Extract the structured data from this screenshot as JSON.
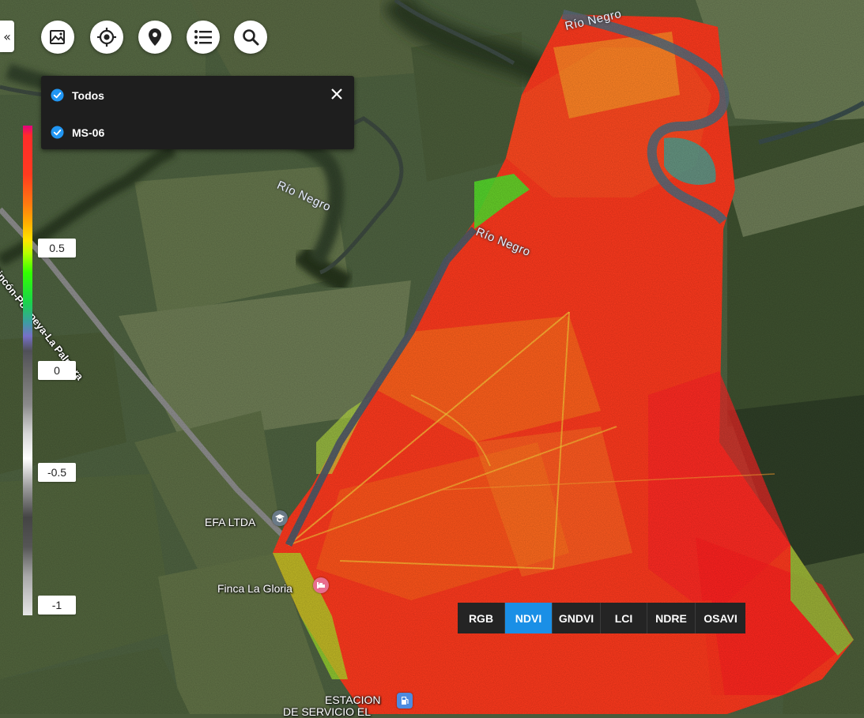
{
  "toolbar": {
    "collapse_symbol": "«",
    "buttons": [
      {
        "icon": "image-layer-icon"
      },
      {
        "icon": "locate-icon"
      },
      {
        "icon": "map-pin-icon"
      },
      {
        "icon": "list-icon"
      },
      {
        "icon": "search-icon"
      }
    ]
  },
  "layers_panel": {
    "items": [
      {
        "label": "Todos",
        "checked": true
      },
      {
        "label": "MS-06",
        "checked": true
      }
    ],
    "check_color": "#2196f3"
  },
  "legend": {
    "labels": [
      "0.5",
      "0",
      "-0.5",
      "-1"
    ]
  },
  "index_switcher": {
    "options": [
      "RGB",
      "NDVI",
      "GNDVI",
      "LCI",
      "NDRE",
      "OSAVI"
    ],
    "active": "NDVI",
    "accent": "#1a8fe6"
  },
  "map": {
    "rivers": [
      "Río Negro",
      "Río Negro",
      "Río Negro"
    ],
    "road": "Rincón-Pompeya-La Palmera",
    "places": {
      "efa": "EFA LTDA",
      "finca": "Finca La Gloria",
      "estacion_line1": "ESTACION",
      "estacion_line2": "DE SERVICIO EL"
    }
  }
}
